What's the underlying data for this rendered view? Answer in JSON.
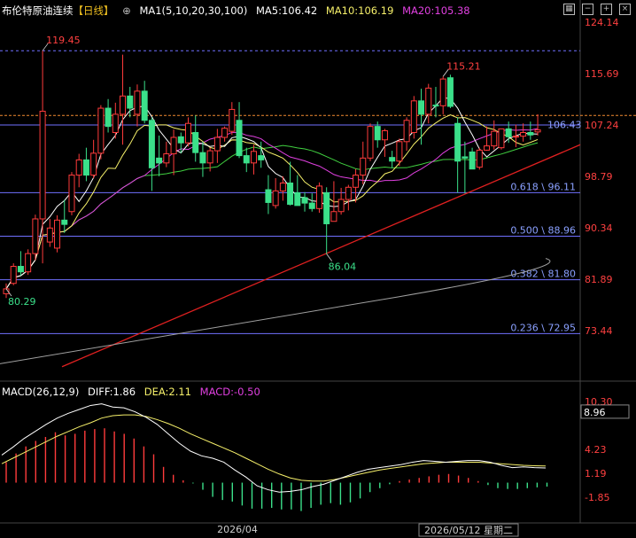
{
  "header": {
    "instrument": "布伦特原油连续",
    "period": "【日线】",
    "indicator": "MA1(5,10,20,30,100)",
    "ma5": "MA5:106.42",
    "ma10": "MA10:106.19",
    "ma20": "MA20:105.38"
  },
  "toolbar_icons": [
    "grid-icon",
    "minus-icon",
    "plus-icon",
    "close-icon"
  ],
  "macd_header": {
    "label": "MACD(26,12,9)",
    "diff": "DIFF:1.86",
    "dea": "DEA:2.11",
    "macd": "MACD:-0.50"
  },
  "colors": {
    "up": "#ff3b3b",
    "down": "#3be08a",
    "ma5": "#ffffff",
    "ma10": "#f6f06a",
    "ma20": "#e040e0",
    "ma30": "#40d040",
    "ma100": "#a0a0a0",
    "trend": "#e02020",
    "fib": "#7070ff",
    "last_price": "#f08a30"
  },
  "chart_data": {
    "type": "candlestick",
    "price_axis": {
      "ticks": [
        124.14,
        115.69,
        107.24,
        98.79,
        90.34,
        81.89,
        73.44
      ]
    },
    "macd_axis": {
      "ticks": [
        10.3,
        4.23,
        1.19,
        -1.85
      ]
    },
    "x_labels": [
      "2026/04",
      "2026/05/12 星期二"
    ],
    "current_price": 106.43,
    "macd_marker": 8.96,
    "annotations": [
      {
        "text": "119.45",
        "value": 119.45,
        "kind": "high"
      },
      {
        "text": "115.21",
        "value": 115.21,
        "kind": "high"
      },
      {
        "text": "86.04",
        "value": 86.04,
        "kind": "low"
      },
      {
        "text": "80.29",
        "value": 80.29,
        "kind": "low"
      }
    ],
    "fib_levels": [
      {
        "text": "0.618 \\ 96.11",
        "value": 96.11
      },
      {
        "text": "0.500 \\ 88.96",
        "value": 88.96
      },
      {
        "text": "0.382 \\ 81.80",
        "value": 81.8
      },
      {
        "text": "0.236 \\ 72.95",
        "value": 72.95
      }
    ],
    "top_level": 119.45,
    "candles": [
      [
        79.5,
        81.2,
        78.8,
        80.3
      ],
      [
        81.2,
        84.5,
        80.9,
        84.0
      ],
      [
        84.0,
        86.5,
        82.5,
        83.1
      ],
      [
        83.1,
        86.8,
        82.6,
        86.1
      ],
      [
        86.1,
        92.5,
        85.0,
        91.8
      ],
      [
        91.8,
        119.45,
        84.5,
        109.5
      ],
      [
        88.0,
        91.8,
        87.2,
        90.3
      ],
      [
        87.0,
        92.4,
        86.3,
        91.6
      ],
      [
        91.6,
        94.9,
        89.5,
        90.9
      ],
      [
        93.0,
        99.5,
        92.4,
        99.0
      ],
      [
        99.0,
        102.5,
        97.0,
        101.5
      ],
      [
        101.5,
        103.5,
        98.0,
        99.0
      ],
      [
        99.0,
        104.8,
        98.5,
        102.6
      ],
      [
        102.6,
        110.5,
        101.6,
        110.0
      ],
      [
        110.0,
        111.5,
        106.0,
        107.0
      ],
      [
        106.0,
        110.9,
        105.0,
        109.0
      ],
      [
        109.0,
        118.8,
        104.0,
        112.0
      ],
      [
        112.0,
        113.5,
        108.5,
        110.0
      ],
      [
        109.0,
        113.9,
        107.0,
        112.8
      ],
      [
        112.8,
        114.5,
        107.5,
        108.0
      ],
      [
        108.0,
        108.5,
        96.4,
        100.2
      ],
      [
        101.8,
        105.5,
        98.8,
        101.0
      ],
      [
        101.0,
        104.5,
        100.3,
        102.5
      ],
      [
        102.5,
        106.5,
        99.0,
        105.2
      ],
      [
        105.3,
        106.0,
        102.6,
        104.3
      ],
      [
        104.3,
        108.5,
        103.7,
        107.5
      ],
      [
        106.0,
        108.8,
        101.2,
        102.7
      ],
      [
        102.7,
        104.5,
        98.7,
        101.0
      ],
      [
        101.0,
        103.5,
        99.6,
        103.0
      ],
      [
        103.0,
        106.6,
        101.0,
        105.2
      ],
      [
        105.2,
        107.0,
        104.5,
        106.7
      ],
      [
        106.2,
        111.0,
        105.6,
        109.8
      ],
      [
        108.0,
        111.0,
        101.8,
        102.2
      ],
      [
        102.2,
        103.5,
        99.5,
        101.0
      ],
      [
        101.0,
        104.0,
        99.1,
        102.9
      ],
      [
        102.2,
        104.5,
        100.2,
        101.5
      ],
      [
        96.6,
        99.0,
        92.6,
        94.5
      ],
      [
        94.0,
        98.5,
        93.5,
        96.4
      ],
      [
        96.4,
        98.8,
        94.8,
        97.7
      ],
      [
        97.7,
        101.2,
        94.0,
        94.2
      ],
      [
        96.1,
        99.0,
        94.5,
        94.0
      ],
      [
        95.3,
        96.2,
        93.0,
        94.4
      ],
      [
        94.4,
        96.0,
        93.0,
        93.5
      ],
      [
        93.5,
        97.8,
        92.8,
        97.2
      ],
      [
        96.1,
        97.0,
        86.04,
        91.0
      ],
      [
        91.4,
        98.0,
        91.4,
        93.0
      ],
      [
        93.0,
        96.9,
        92.5,
        95.0
      ],
      [
        95.0,
        97.4,
        93.2,
        97.0
      ],
      [
        97.0,
        100.0,
        94.5,
        99.0
      ],
      [
        99.0,
        104.5,
        97.5,
        101.8
      ],
      [
        101.8,
        107.5,
        101.3,
        107.0
      ],
      [
        107.0,
        107.8,
        103.5,
        104.8
      ],
      [
        104.8,
        106.6,
        102.0,
        106.3
      ],
      [
        101.9,
        103.0,
        100.2,
        101.3
      ],
      [
        101.3,
        105.0,
        100.5,
        104.5
      ],
      [
        104.5,
        108.5,
        103.0,
        108.0
      ],
      [
        106.0,
        112.0,
        105.0,
        111.2
      ],
      [
        111.2,
        113.2,
        104.0,
        109.0
      ],
      [
        109.0,
        114.0,
        107.5,
        113.3
      ],
      [
        110.5,
        113.5,
        108.5,
        110.4
      ],
      [
        110.4,
        115.21,
        109.0,
        114.8
      ],
      [
        115.0,
        115.5,
        110.0,
        110.3
      ],
      [
        107.5,
        108.5,
        96.1,
        101.3
      ],
      [
        102.0,
        104.5,
        96.0,
        101.8
      ],
      [
        102.8,
        103.5,
        100.0,
        100.0
      ],
      [
        100.3,
        103.5,
        99.9,
        103.1
      ],
      [
        103.1,
        107.0,
        103.0,
        103.8
      ],
      [
        103.8,
        108.0,
        103.2,
        106.2
      ],
      [
        103.5,
        106.6,
        103.2,
        106.6
      ],
      [
        106.6,
        107.8,
        104.3,
        105.3
      ],
      [
        105.3,
        107.3,
        103.6,
        105.4
      ],
      [
        105.4,
        107.5,
        104.5,
        106.0
      ],
      [
        106.0,
        107.8,
        104.8,
        105.6
      ],
      [
        106.1,
        109.0,
        105.5,
        106.43
      ]
    ],
    "macd_hist": [
      2.6,
      3.7,
      4.6,
      5.3,
      5.8,
      6.4,
      6.0,
      6.2,
      6.6,
      6.8,
      6.9,
      6.5,
      6.2,
      5.6,
      4.6,
      3.6,
      2.0,
      1.0,
      0.3,
      -0.1,
      -0.9,
      -1.8,
      -2.2,
      -2.4,
      -2.9,
      -3.3,
      -3.3,
      -3.2,
      -3.4,
      -3.4,
      -3.6,
      -3.2,
      -2.8,
      -2.6,
      -2.8,
      -2.5,
      -2.0,
      -1.2,
      -0.7,
      -0.2,
      0.2,
      0.4,
      0.6,
      0.8,
      1.0,
      1.1,
      0.9,
      0.6,
      0.2,
      -0.3,
      -0.7,
      -0.8,
      -0.8,
      -0.7,
      -0.6,
      -0.5
    ],
    "macd_dif": [
      3.5,
      4.5,
      5.6,
      6.5,
      7.4,
      8.2,
      8.8,
      9.3,
      9.8,
      10.0,
      9.6,
      9.5,
      9.0,
      8.3,
      7.4,
      6.2,
      5.0,
      4.0,
      3.4,
      3.1,
      2.6,
      1.6,
      0.7,
      -0.4,
      -0.9,
      -1.2,
      -1.1,
      -0.9,
      -0.5,
      -0.2,
      0.3,
      0.8,
      1.3,
      1.7,
      1.9,
      2.1,
      2.3,
      2.6,
      2.8,
      2.7,
      2.6,
      2.7,
      2.8,
      2.8,
      2.6,
      2.2,
      1.9,
      2.0,
      1.9,
      1.86
    ],
    "macd_dea": [
      2.4,
      3.1,
      3.8,
      4.5,
      5.2,
      5.9,
      6.5,
      7.1,
      7.6,
      8.2,
      8.5,
      8.6,
      8.6,
      8.4,
      8.0,
      7.5,
      6.9,
      6.2,
      5.6,
      5.0,
      4.4,
      3.8,
      3.1,
      2.4,
      1.7,
      1.1,
      0.6,
      0.3,
      0.2,
      0.2,
      0.4,
      0.7,
      1.0,
      1.3,
      1.6,
      1.8,
      2.0,
      2.2,
      2.4,
      2.5,
      2.6,
      2.6,
      2.6,
      2.6,
      2.5,
      2.4,
      2.3,
      2.2,
      2.15,
      2.11
    ]
  }
}
